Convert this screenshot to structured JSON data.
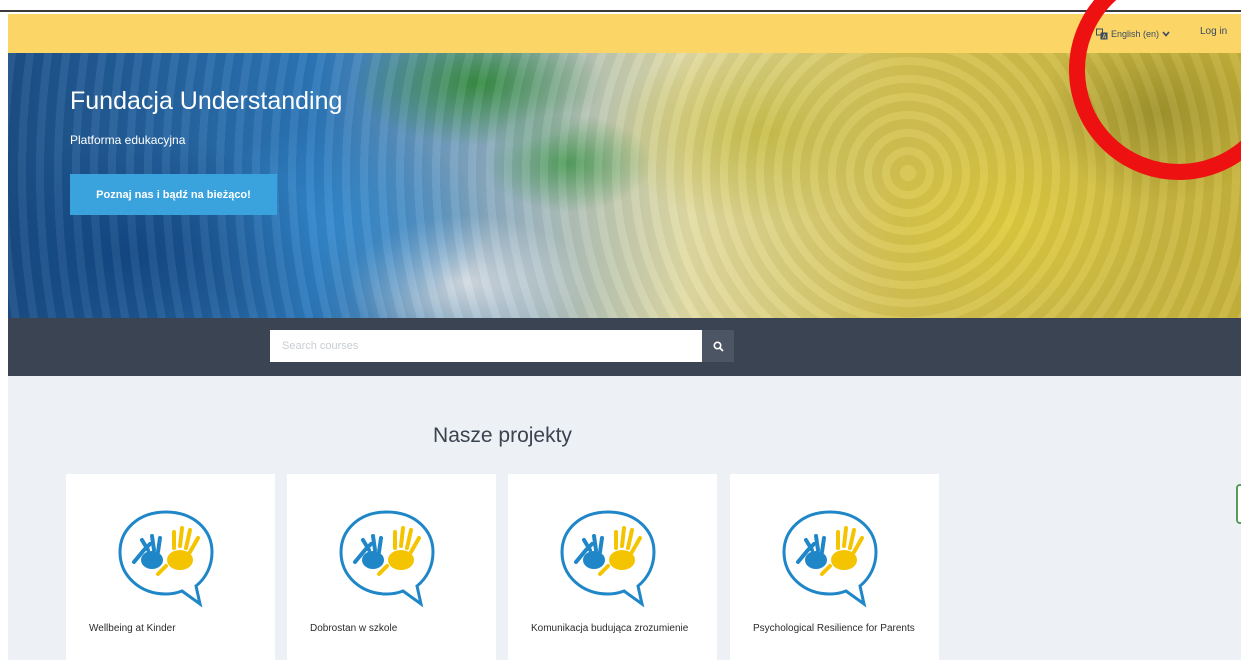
{
  "navbar": {
    "language_label": "English (en)",
    "login_label": "Log in",
    "language_icon": "translate-icon",
    "dropdown_icon": "chevron-down-icon"
  },
  "hero": {
    "title": "Fundacja Understanding",
    "subtitle": "Platforma edukacyjna",
    "button_label": "Poznaj nas i bądź na bieżąco!"
  },
  "search": {
    "placeholder": "Search courses",
    "icon": "search-icon"
  },
  "projects": {
    "heading": "Nasze projekty",
    "cards": [
      {
        "title": "Wellbeing at Kinder"
      },
      {
        "title": "Dobrostan w szkole"
      },
      {
        "title": "Komunikacja budująca zrozumienie"
      },
      {
        "title": "Psychological Resilience for Parents"
      }
    ]
  },
  "colors": {
    "navbar_bg": "#fbd666",
    "hero_button": "#3aa3dd",
    "search_band": "#3a4452",
    "main_bg": "#edf1f5",
    "annotation_ring": "#ee1111",
    "logo_blue": "#1f86c8",
    "logo_yellow": "#f5c400"
  }
}
